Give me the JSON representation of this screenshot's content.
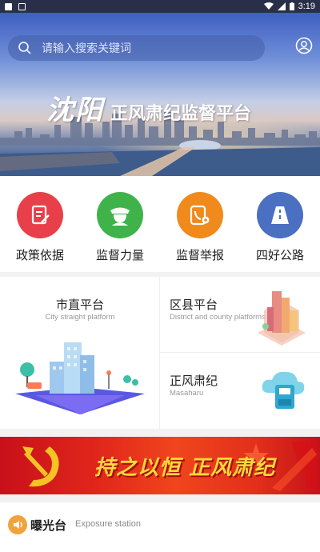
{
  "status_bar": {
    "time": "3:19"
  },
  "search": {
    "placeholder": "请输入搜索关键词"
  },
  "hero": {
    "calligraphy": "沈阳",
    "subtitle": "正风肃纪监督平台"
  },
  "quick_menu": [
    {
      "label": "政策依据",
      "icon": "policy-document-icon",
      "color": "#e8404a"
    },
    {
      "label": "监督力量",
      "icon": "police-officer-icon",
      "color": "#3fb34a"
    },
    {
      "label": "监督举报",
      "icon": "report-phone-icon",
      "color": "#f08a1c"
    },
    {
      "label": "四好公路",
      "icon": "road-icon",
      "color": "#4b6fc1"
    }
  ],
  "platforms": {
    "city": {
      "title": "市直平台",
      "subtitle": "City straight platform"
    },
    "district": {
      "title": "区县平台",
      "subtitle": "District and county platforms"
    },
    "discipline": {
      "title": "正风肃纪",
      "subtitle": "Masaharu"
    }
  },
  "banner": {
    "text": "持之以恒 正风肃纪"
  },
  "exposure": {
    "title": "曝光台",
    "subtitle": "Exposure station"
  }
}
